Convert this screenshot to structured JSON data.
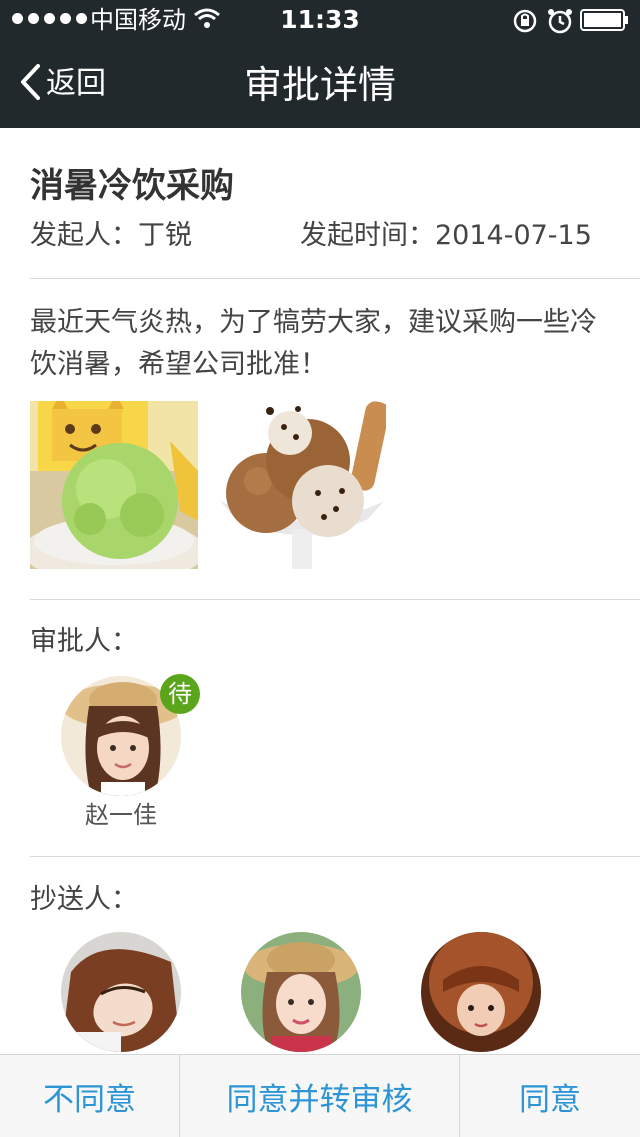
{
  "status_bar": {
    "carrier": "中国移动",
    "time": "11:33"
  },
  "nav": {
    "back_label": "返回",
    "title": "审批详情"
  },
  "request": {
    "title": "消暑冷饮采购",
    "initiator_label": "发起人：",
    "initiator": "丁锐",
    "time_label": "发起时间：",
    "time": "2014-07-15",
    "description": "最近天气炎热，为了犒劳大家，建议采购一些冷饮消暑，希望公司批准！"
  },
  "approvers": {
    "label": "审批人：",
    "people": [
      {
        "name": "赵一佳",
        "badge": "待"
      }
    ]
  },
  "cc": {
    "label": "抄送人："
  },
  "actions": {
    "reject": "不同意",
    "agree_forward": "同意并转审核",
    "agree": "同意"
  },
  "colors": {
    "header_bg": "#22292c",
    "accent_blue": "#2d95d6",
    "badge_green": "#5aa51c"
  }
}
